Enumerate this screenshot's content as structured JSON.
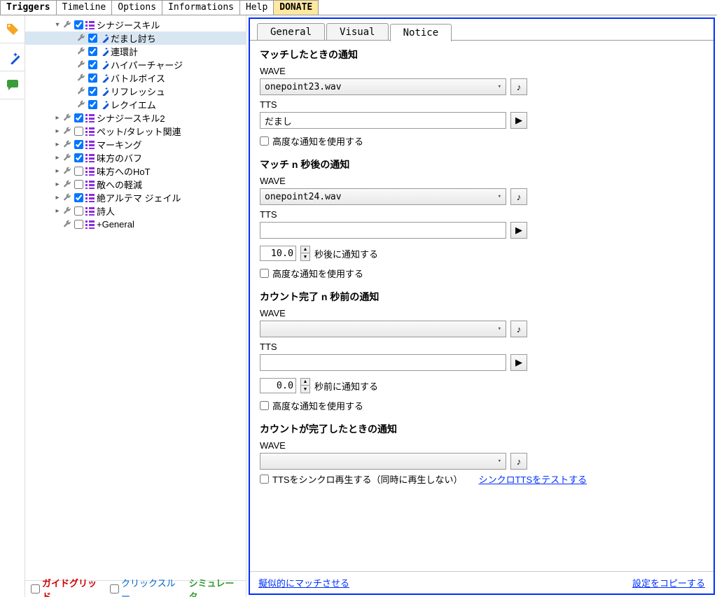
{
  "top_tabs": [
    "Triggers",
    "Timeline",
    "Options",
    "Informations",
    "Help",
    "DONATE"
  ],
  "active_top_tab": 0,
  "side_icons": [
    "tag-icon",
    "wand-icon",
    "chat-icon"
  ],
  "tree": [
    {
      "depth": 0,
      "expand": "▾",
      "wrench": true,
      "checked": true,
      "icon": "group",
      "label": "シナジースキル",
      "selected": false
    },
    {
      "depth": 1,
      "expand": "",
      "wrench": true,
      "checked": true,
      "icon": "trigger",
      "label": "だまし討ち",
      "selected": true
    },
    {
      "depth": 1,
      "expand": "",
      "wrench": true,
      "checked": true,
      "icon": "trigger",
      "label": "連環計",
      "selected": false
    },
    {
      "depth": 1,
      "expand": "",
      "wrench": true,
      "checked": true,
      "icon": "trigger",
      "label": "ハイパーチャージ",
      "selected": false
    },
    {
      "depth": 1,
      "expand": "",
      "wrench": true,
      "checked": true,
      "icon": "trigger",
      "label": "バトルボイス",
      "selected": false
    },
    {
      "depth": 1,
      "expand": "",
      "wrench": true,
      "checked": true,
      "icon": "trigger",
      "label": "リフレッシュ",
      "selected": false
    },
    {
      "depth": 1,
      "expand": "",
      "wrench": true,
      "checked": true,
      "icon": "trigger",
      "label": "レクイエム",
      "selected": false
    },
    {
      "depth": 0,
      "expand": "▸",
      "wrench": true,
      "checked": true,
      "icon": "group",
      "label": "シナジースキル2",
      "selected": false
    },
    {
      "depth": 0,
      "expand": "▸",
      "wrench": true,
      "checked": false,
      "icon": "group",
      "label": "ペット/タレット関連",
      "selected": false
    },
    {
      "depth": 0,
      "expand": "▸",
      "wrench": true,
      "checked": true,
      "icon": "group",
      "label": "マーキング",
      "selected": false
    },
    {
      "depth": 0,
      "expand": "▸",
      "wrench": true,
      "checked": true,
      "icon": "group",
      "label": "味方のバフ",
      "selected": false
    },
    {
      "depth": 0,
      "expand": "▸",
      "wrench": true,
      "checked": false,
      "icon": "group",
      "label": "味方へのHoT",
      "selected": false
    },
    {
      "depth": 0,
      "expand": "▸",
      "wrench": true,
      "checked": false,
      "icon": "group",
      "label": "敵への軽減",
      "selected": false
    },
    {
      "depth": 0,
      "expand": "▸",
      "wrench": true,
      "checked": true,
      "icon": "group",
      "label": "絶アルテマ  ジェイル",
      "selected": false
    },
    {
      "depth": 0,
      "expand": "▸",
      "wrench": true,
      "checked": false,
      "icon": "group",
      "label": "詩人",
      "selected": false
    },
    {
      "depth": 0,
      "expand": "",
      "wrench": true,
      "checked": false,
      "icon": "group",
      "label": "+General",
      "selected": false
    }
  ],
  "tree_footer": {
    "guide_grid": "ガイドグリッド",
    "click_through": "クリックスルー",
    "simulator": "シミュレータ"
  },
  "inner_tabs": [
    "General",
    "Visual",
    "Notice"
  ],
  "active_inner_tab": 2,
  "notice": {
    "sections": [
      {
        "title": "マッチしたときの通知",
        "wave_label": "WAVE",
        "wave_value": "onepoint23.wav",
        "tts_label": "TTS",
        "tts_value": "だまし",
        "delay_value": "",
        "delay_suffix": "",
        "adv_label": "高度な通知を使用する",
        "adv_checked": false,
        "has_delay": false
      },
      {
        "title": "マッチ n 秒後の通知",
        "wave_label": "WAVE",
        "wave_value": "onepoint24.wav",
        "tts_label": "TTS",
        "tts_value": "",
        "delay_value": "10.0",
        "delay_suffix": "秒後に通知する",
        "adv_label": "高度な通知を使用する",
        "adv_checked": false,
        "has_delay": true
      },
      {
        "title": "カウント完了 n 秒前の通知",
        "wave_label": "WAVE",
        "wave_value": "",
        "tts_label": "TTS",
        "tts_value": "",
        "delay_value": "0.0",
        "delay_suffix": "秒前に通知する",
        "adv_label": "高度な通知を使用する",
        "adv_checked": false,
        "has_delay": true
      },
      {
        "title": "カウントが完了したときの通知",
        "wave_label": "WAVE",
        "wave_value": "",
        "tts_label": "",
        "tts_value": "",
        "delay_value": "",
        "delay_suffix": "",
        "adv_label": "",
        "adv_checked": false,
        "has_delay": false,
        "hide_tts": true
      }
    ],
    "sync_tts_label": "TTSをシンクロ再生する（同時に再生しない）",
    "sync_tts_test": "シンクロTTSをテストする"
  },
  "bottom_bar": {
    "simulate_match": "擬似的にマッチさせる",
    "copy_settings": "設定をコピーする"
  }
}
